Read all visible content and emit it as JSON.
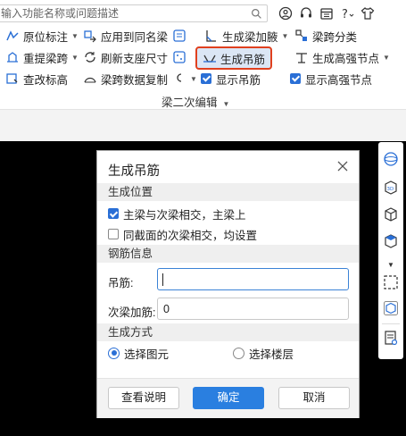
{
  "search": {
    "placeholder": "输入功能名称或问题描述"
  },
  "ribbon": {
    "row1": {
      "b1": "原位标注",
      "b2": "应用到同名梁",
      "b3": "生成梁加腋",
      "b4": "梁跨分类"
    },
    "row2": {
      "b1": "重提梁跨",
      "b2": "刷新支座尺寸",
      "b3": "生成吊筋",
      "b4": "生成高强节点"
    },
    "row3": {
      "b1": "查改标高",
      "b2": "梁跨数据复制",
      "b3": "显示吊筋",
      "b4": "显示高强节点"
    },
    "group_label": "梁二次编辑"
  },
  "dialog": {
    "title": "生成吊筋",
    "section_position": "生成位置",
    "opt_main_secondary": "主梁与次梁相交，主梁上",
    "opt_main_secondary_checked": true,
    "opt_same_section": "同截面的次梁相交，均设置",
    "opt_same_section_checked": false,
    "section_rebar": "钢筋信息",
    "hanger_label": "吊筋:",
    "hanger_value": "",
    "secondary_label": "次梁加筋:",
    "secondary_value": "0",
    "section_method": "生成方式",
    "radio_select_elements": "选择图元",
    "radio_select_floors": "选择楼层",
    "selected_method": "选择图元",
    "btn_help": "查看说明",
    "btn_ok": "确定",
    "btn_cancel": "取消"
  },
  "colors": {
    "accent": "#2a7fe0",
    "highlight_border": "#e0401e",
    "checkbox": "#2a6fd6"
  },
  "icons": [
    "search-icon",
    "user-icon",
    "headset-icon",
    "calendar-icon",
    "help-icon",
    "shirt-icon",
    "close-icon",
    "sphere-icon",
    "3d-view-icon",
    "cube-icon",
    "cube-filled-icon",
    "select-box-icon",
    "package-icon",
    "document-view-icon"
  ]
}
